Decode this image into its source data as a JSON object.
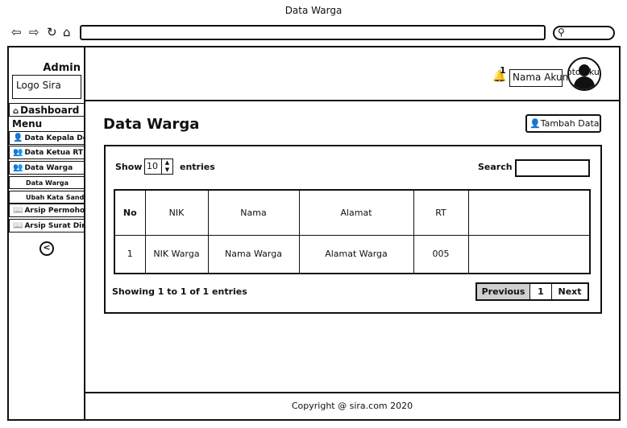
{
  "browser": {
    "title": "Data Warga",
    "back_icon": "back-arrow-icon",
    "forward_icon": "forward-arrow-icon",
    "refresh_icon": "refresh-icon",
    "home_icon": "home-icon",
    "search_icon": "search-icon"
  },
  "sidebar": {
    "admin_label": "Admin",
    "logo_label": "Logo Sira",
    "dashboard_label": "Dashboard",
    "menu_label": "Menu",
    "items": [
      {
        "label": "Data Kepala Desa"
      },
      {
        "label": "Data Ketua RT"
      },
      {
        "label": "Data Warga"
      }
    ],
    "sub_items": [
      {
        "label": "Data Warga"
      },
      {
        "label": "Ubah Kata Sandi Warga"
      }
    ],
    "archive_items": [
      {
        "label": "Arsip Permohonan"
      },
      {
        "label": "Arsip Surat Dinas"
      }
    ]
  },
  "topbar": {
    "notification_count": "1",
    "account_name": "Nama Akun",
    "avatar_label": "foto akun"
  },
  "main": {
    "page_title": "Data Warga",
    "add_button_label": "Tambah Data",
    "show_label": "Show",
    "entries_value": "10",
    "entries_label": "entries",
    "search_label": "Search",
    "search_value": "",
    "table": {
      "headers": [
        "No",
        "NIK",
        "Nama",
        "Alamat",
        "RT",
        ""
      ],
      "rows": [
        [
          "1",
          "NIK Warga",
          "Nama Warga",
          "Alamat Warga",
          "005",
          ""
        ]
      ]
    },
    "info_text": "Showing 1 to 1 of 1 entries",
    "pagination": {
      "previous_label": "Previous",
      "current_page": "1",
      "next_label": "Next"
    }
  },
  "footer": {
    "copyright": "Copyright @ sira.com 2020"
  }
}
